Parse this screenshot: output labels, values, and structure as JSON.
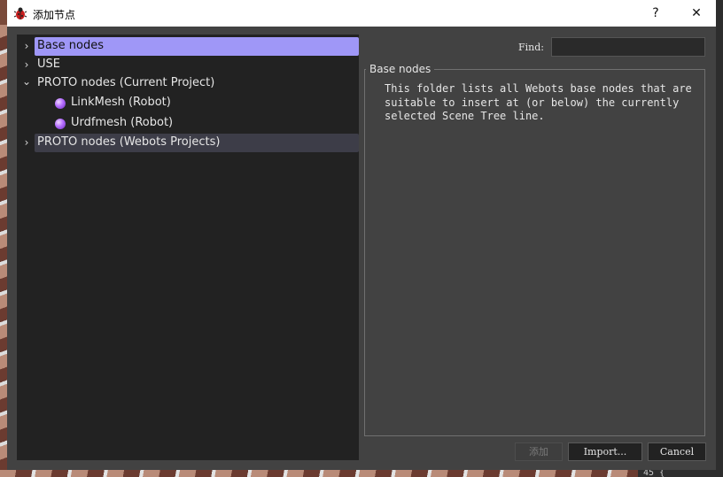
{
  "window": {
    "title": "添加节点",
    "help_label": "?",
    "close_label": "✕"
  },
  "tree": {
    "expand_arrow": "›",
    "collapse_arrow": "⌄",
    "items": [
      {
        "label": "Base nodes"
      },
      {
        "label": "USE"
      },
      {
        "label": "PROTO nodes (Current Project)"
      },
      {
        "label": "LinkMesh (Robot)"
      },
      {
        "label": "Urdfmesh (Robot)"
      },
      {
        "label": "PROTO nodes (Webots Projects)"
      }
    ]
  },
  "find": {
    "label": "Find:",
    "value": ""
  },
  "info": {
    "title": "Base nodes",
    "description": "This folder lists all Webots base nodes that are suitable to insert at (or below) the currently selected Scene Tree line."
  },
  "buttons": {
    "add": "添加",
    "import": "Import...",
    "cancel": "Cancel"
  },
  "colors": {
    "selection": "#9f97f7",
    "proto_bullet": "#b36cff",
    "panel": "#424242",
    "tree_bg": "#222222"
  },
  "background_code": {
    "line_number": "45",
    "text": "{"
  }
}
